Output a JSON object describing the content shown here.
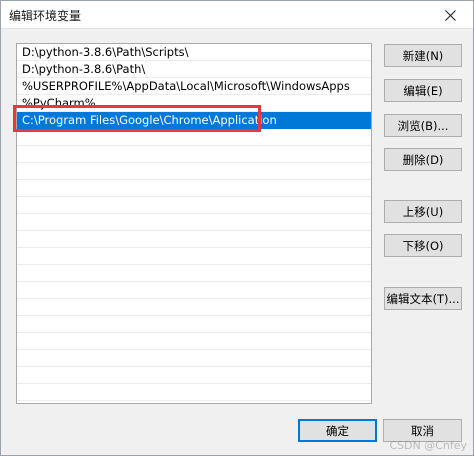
{
  "window": {
    "title": "编辑环境变量"
  },
  "paths": {
    "items": [
      "D:\\python-3.8.6\\Path\\Scripts\\",
      "D:\\python-3.8.6\\Path\\",
      "%USERPROFILE%\\AppData\\Local\\Microsoft\\WindowsApps",
      "%PyCharm%",
      "C:\\Program Files\\Google\\Chrome\\Application"
    ],
    "selected_index": 4
  },
  "buttons": {
    "new": "新建(N)",
    "edit": "编辑(E)",
    "browse": "浏览(B)...",
    "delete": "删除(D)",
    "move_up": "上移(U)",
    "move_down": "下移(O)",
    "edit_text": "编辑文本(T)...",
    "ok": "确定",
    "cancel": "取消"
  },
  "watermark": "CSDN @Cnfey",
  "colors": {
    "selection": "#0078d7",
    "annotation": "#e8383d"
  },
  "icons": {
    "close": "close-icon"
  }
}
